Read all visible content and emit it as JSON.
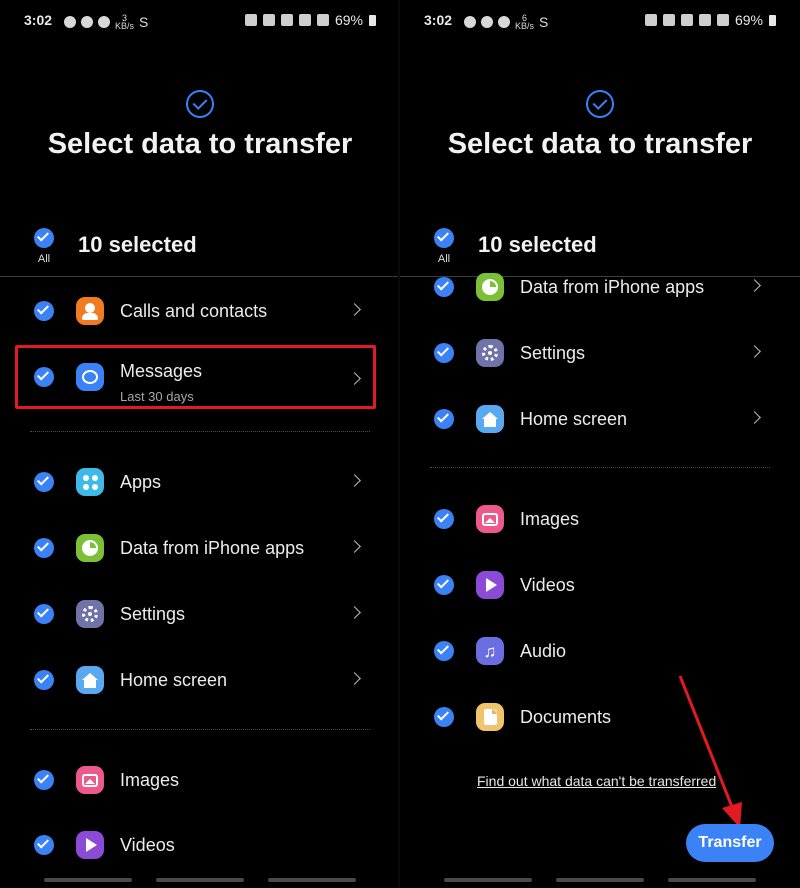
{
  "status_bar": {
    "time": "3:02",
    "left_kbs": "3\nKB/s",
    "right_kbs": "6\nKB/s",
    "s_glyph": "S",
    "battery_text": "69%"
  },
  "header": {
    "title": "Select data to transfer"
  },
  "selection": {
    "all_label": "All",
    "count_label": "10 selected"
  },
  "colors": {
    "accent": "#3b82f6",
    "highlight": "#e21b23",
    "calls": "#f07b21",
    "messages": "#3b82f6",
    "apps": "#3eb9e8",
    "data_from_iphone": "#7cc038",
    "settings": "#6f73a8",
    "home": "#5aa8f0",
    "images": "#ec5a8b",
    "videos": "#8b4bd6",
    "audio": "#6b6ee0",
    "documents": "#f0c46c"
  },
  "left_list": [
    {
      "label": "Calls and contacts",
      "icon": "person-icon",
      "chevron": true
    },
    {
      "label": "Messages",
      "sub": "Last 30 days",
      "icon": "message-bubble-icon",
      "chevron": true,
      "highlighted": true
    },
    {
      "label": "Apps",
      "icon": "apps-grid-icon",
      "chevron": true
    },
    {
      "label": "Data from iPhone apps",
      "icon": "pie-chart-icon",
      "chevron": true
    },
    {
      "label": "Settings",
      "icon": "gear-icon",
      "chevron": true
    },
    {
      "label": "Home screen",
      "icon": "home-icon",
      "chevron": true
    },
    {
      "label": "Images",
      "icon": "image-icon",
      "chevron": false
    },
    {
      "label": "Videos",
      "icon": "play-icon",
      "chevron": false
    }
  ],
  "right_list": [
    {
      "label": "Data from iPhone apps",
      "icon": "pie-chart-icon",
      "chevron": true
    },
    {
      "label": "Settings",
      "icon": "gear-icon",
      "chevron": true
    },
    {
      "label": "Home screen",
      "icon": "home-icon",
      "chevron": true
    },
    {
      "label": "Images",
      "icon": "image-icon",
      "chevron": false
    },
    {
      "label": "Videos",
      "icon": "play-icon",
      "chevron": false
    },
    {
      "label": "Audio",
      "icon": "music-note-icon",
      "chevron": false
    },
    {
      "label": "Documents",
      "icon": "document-icon",
      "chevron": false
    }
  ],
  "footer": {
    "link_text": "Find out what data can't be transferred",
    "transfer_label": "Transfer"
  }
}
